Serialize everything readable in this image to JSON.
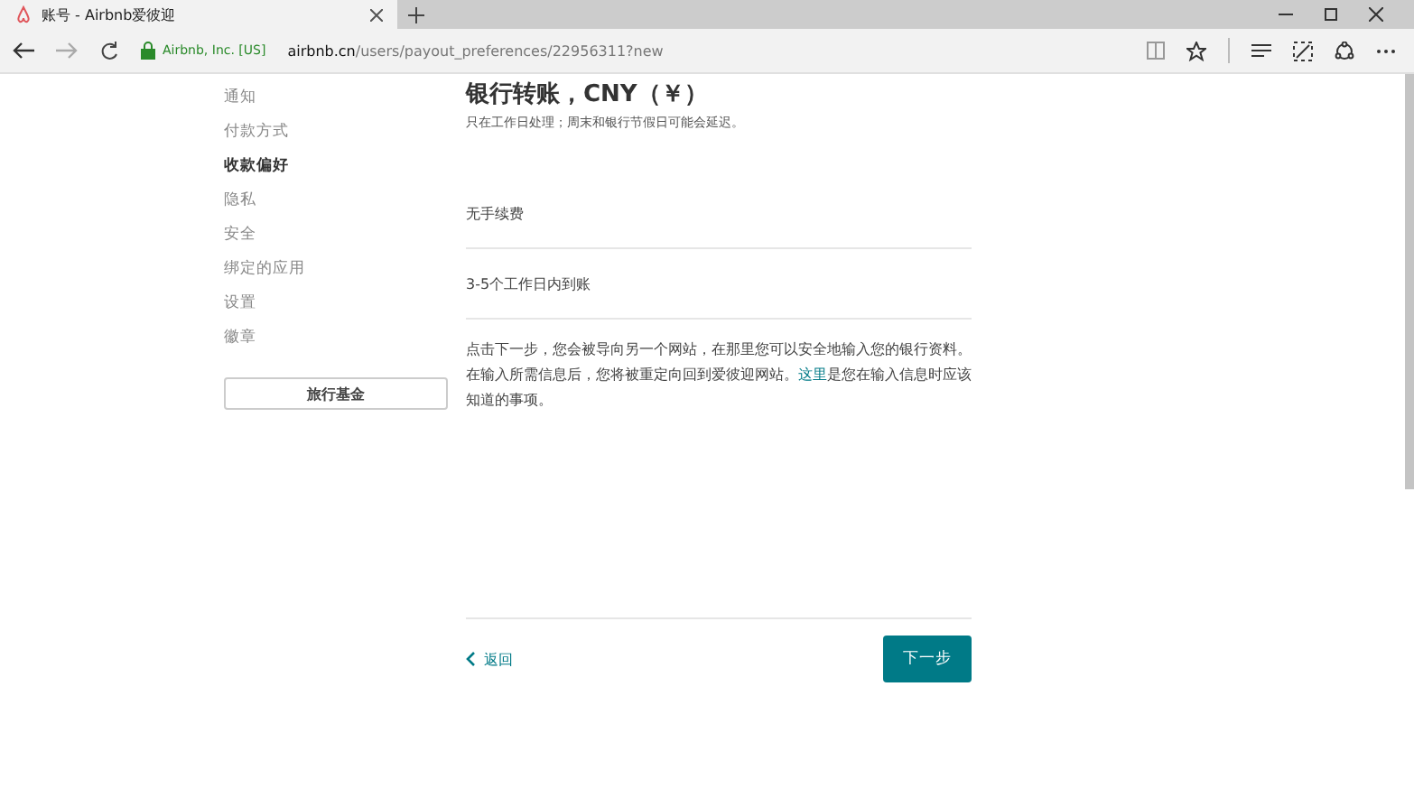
{
  "browser": {
    "tab_title": "账号 - Airbnb爱彼迎",
    "cert": "Airbnb, Inc. [US]",
    "url_host": "airbnb.cn",
    "url_path": "/users/payout_preferences/22956311?new"
  },
  "sidebar": {
    "items": [
      {
        "label": "通知",
        "selected": false
      },
      {
        "label": "付款方式",
        "selected": false
      },
      {
        "label": "收款偏好",
        "selected": true
      },
      {
        "label": "隐私",
        "selected": false
      },
      {
        "label": "安全",
        "selected": false
      },
      {
        "label": "绑定的应用",
        "selected": false
      },
      {
        "label": "设置",
        "selected": false
      },
      {
        "label": "徽章",
        "selected": false
      }
    ],
    "button": "旅行基金"
  },
  "main": {
    "title": "银行转账，CNY（￥）",
    "subtitle": "只在工作日处理；周末和银行节假日可能会延迟。",
    "rows": [
      "无手续费",
      "3-5个工作日内到账"
    ],
    "note_before": "点击下一步，您会被导向另一个网站，在那里您可以安全地输入您的银行资料。在输入所需信息后，您将被重定向回到爱彼迎网站。",
    "note_link": "这里",
    "note_after": "是您在输入信息时应该知道的事项。",
    "back": "返回",
    "next": "下一步"
  }
}
